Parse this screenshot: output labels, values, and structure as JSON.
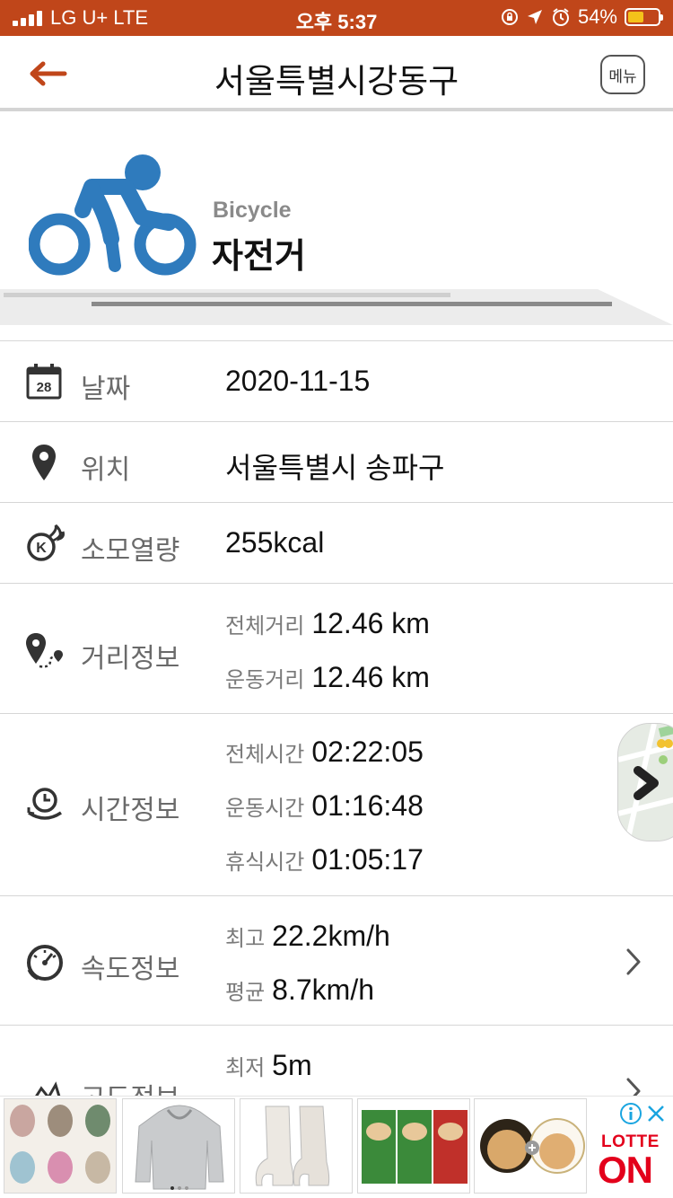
{
  "status_bar": {
    "carrier": "LG U+  LTE",
    "time": "오후 5:37",
    "battery": "54%",
    "battery_level": 0.54
  },
  "header": {
    "title": "서울특별시강동구",
    "menu_label": "메뉴"
  },
  "activity": {
    "sub_en": "Bicycle",
    "title": "자전거",
    "accent_color": "#2f7bbd"
  },
  "rows": {
    "date": {
      "label": "날짜",
      "value": "2020-11-15",
      "icon_number": "28"
    },
    "location": {
      "label": "위치",
      "value": "서울특별시 송파구"
    },
    "calories": {
      "label": "소모열량",
      "value": "255kcal"
    },
    "distance": {
      "label": "거리정보",
      "items": [
        {
          "label": "전체거리",
          "value": "12.46 km"
        },
        {
          "label": "운동거리",
          "value": "12.46 km"
        }
      ]
    },
    "time": {
      "label": "시간정보",
      "items": [
        {
          "label": "전체시간",
          "value": "02:22:05"
        },
        {
          "label": "운동시간",
          "value": "01:16:48"
        },
        {
          "label": "휴식시간",
          "value": "01:05:17"
        }
      ]
    },
    "speed": {
      "label": "속도정보",
      "items": [
        {
          "label": "최고",
          "value": "22.2km/h"
        },
        {
          "label": "평균",
          "value": "8.7km/h"
        }
      ]
    },
    "altitude": {
      "label": "고도정보",
      "items": [
        {
          "label": "최저",
          "value": "5m"
        }
      ]
    }
  },
  "ad": {
    "brand_top": "LOTTE",
    "brand_bottom": "ON",
    "products": [
      "slippers",
      "hoodie",
      "boots",
      "dumplings",
      "cushion"
    ]
  }
}
